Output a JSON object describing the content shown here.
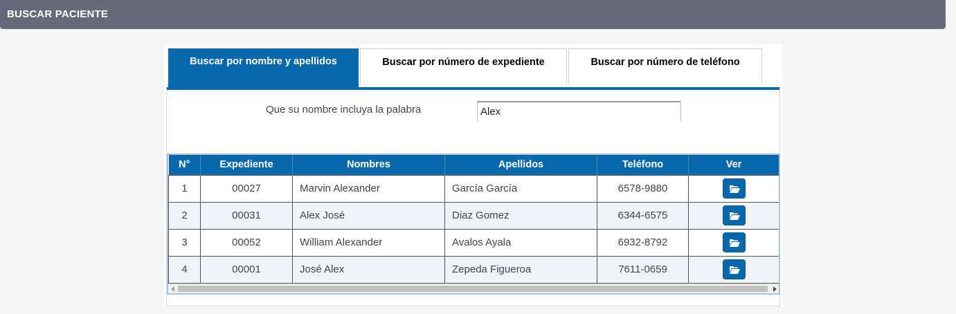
{
  "header": {
    "title": "BUSCAR PACIENTE"
  },
  "tabs": [
    {
      "label": "Buscar por nombre y apellidos",
      "active": true
    },
    {
      "label": "Buscar por número de expediente",
      "active": false
    },
    {
      "label": "Buscar por número de teléfono",
      "active": false
    }
  ],
  "search": {
    "label": "Que su nombre incluya la palabra",
    "value": "Alex"
  },
  "table": {
    "columns": [
      "N°",
      "Expediente",
      "Nombres",
      "Apellidos",
      "Teléfono",
      "Ver"
    ],
    "rows": [
      {
        "num": "1",
        "expediente": "00027",
        "nombres": "Marvin Alexander",
        "apellidos": "García García",
        "telefono": "6578-9880"
      },
      {
        "num": "2",
        "expediente": "00031",
        "nombres": "Alex José",
        "apellidos": "Diaz Gomez",
        "telefono": "6344-6575"
      },
      {
        "num": "3",
        "expediente": "00052",
        "nombres": "William Alexander",
        "apellidos": "Avalos Ayala",
        "telefono": "6932-8792"
      },
      {
        "num": "4",
        "expediente": "00001",
        "nombres": "José Alex",
        "apellidos": "Zepeda Figueroa",
        "telefono": "7611-0659"
      }
    ]
  },
  "colors": {
    "header_bg": "#646a77",
    "accent": "#0868ac"
  },
  "icons": {
    "view": "folder-open-icon"
  }
}
